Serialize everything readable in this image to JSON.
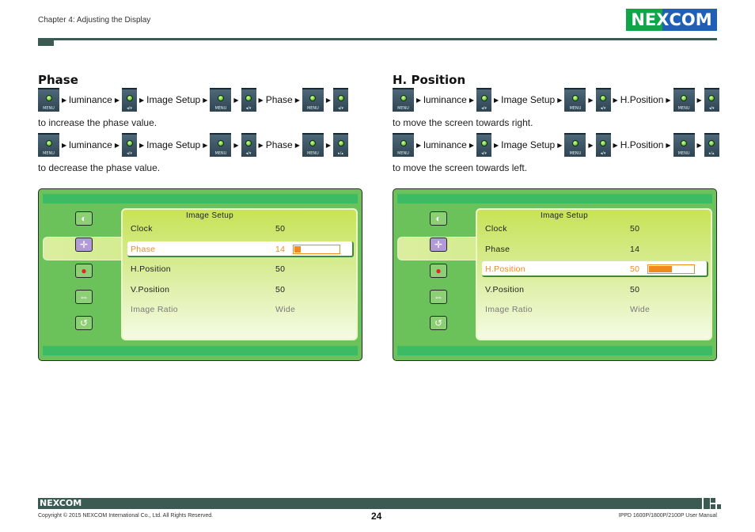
{
  "header": {
    "chapter": "Chapter 4: Adjusting the Display",
    "logo": {
      "ne": "NE",
      "x": "X",
      "com": "COM"
    },
    "colors": {
      "rule": "#3b5a52",
      "logo_green": "#0fa64a",
      "logo_blue": "#1f5fb5"
    }
  },
  "sections": [
    {
      "title": "Phase",
      "procedures": [
        {
          "steps": [
            {
              "type": "button",
              "button": "MENU"
            },
            {
              "type": "label",
              "text": "luminance"
            },
            {
              "type": "button",
              "button": "◂/▾"
            },
            {
              "type": "label",
              "text": "Image Setup"
            },
            {
              "type": "button",
              "button": "MENU"
            },
            {
              "type": "button",
              "button": "◂/▾"
            },
            {
              "type": "label",
              "text": "Phase"
            },
            {
              "type": "button",
              "button": "MENU"
            },
            {
              "type": "button",
              "button": "◂/▾"
            }
          ],
          "note": "to increase the phase value."
        },
        {
          "steps": [
            {
              "type": "button",
              "button": "MENU"
            },
            {
              "type": "label",
              "text": "luminance"
            },
            {
              "type": "button",
              "button": "◂/▾"
            },
            {
              "type": "label",
              "text": "Image Setup"
            },
            {
              "type": "button",
              "button": "MENU"
            },
            {
              "type": "button",
              "button": "◂/▾"
            },
            {
              "type": "label",
              "text": "Phase"
            },
            {
              "type": "button",
              "button": "MENU"
            },
            {
              "type": "button",
              "button": "▸/▴"
            }
          ],
          "note": "to decrease the phase value."
        }
      ],
      "osd": {
        "panel_title": "Image Setup",
        "rows": [
          {
            "label": "Clock",
            "value": "50",
            "state": "normal"
          },
          {
            "label": "Phase",
            "value": "14",
            "state": "selected",
            "meter_percent": 14
          },
          {
            "label": "H.Position",
            "value": "50",
            "state": "normal"
          },
          {
            "label": "V.Position",
            "value": "50",
            "state": "normal"
          },
          {
            "label": "Image Ratio",
            "value": "Wide",
            "state": "disabled"
          }
        ],
        "sidebar_icons": [
          "luminance-icon",
          "image-setup-icon",
          "color-temp-icon",
          "osd-setup-icon",
          "reset-icon"
        ],
        "active_icon": 1
      }
    },
    {
      "title": "H. Position",
      "procedures": [
        {
          "steps": [
            {
              "type": "button",
              "button": "MENU"
            },
            {
              "type": "label",
              "text": "luminance"
            },
            {
              "type": "button",
              "button": "◂/▾"
            },
            {
              "type": "label",
              "text": "Image Setup"
            },
            {
              "type": "button",
              "button": "MENU"
            },
            {
              "type": "button",
              "button": "◂/▾"
            },
            {
              "type": "label",
              "text": "H.Position"
            },
            {
              "type": "button",
              "button": "MENU"
            },
            {
              "type": "button",
              "button": "◂/▾"
            }
          ],
          "note": "to move the screen towards right."
        },
        {
          "steps": [
            {
              "type": "button",
              "button": "MENU"
            },
            {
              "type": "label",
              "text": "luminance"
            },
            {
              "type": "button",
              "button": "◂/▾"
            },
            {
              "type": "label",
              "text": "Image Setup"
            },
            {
              "type": "button",
              "button": "MENU"
            },
            {
              "type": "button",
              "button": "◂/▾"
            },
            {
              "type": "label",
              "text": "H.Position"
            },
            {
              "type": "button",
              "button": "MENU"
            },
            {
              "type": "button",
              "button": "▸/▴"
            }
          ],
          "note": "to move the screen towards left."
        }
      ],
      "osd": {
        "panel_title": "Image Setup",
        "rows": [
          {
            "label": "Clock",
            "value": "50",
            "state": "normal"
          },
          {
            "label": "Phase",
            "value": "14",
            "state": "normal"
          },
          {
            "label": "H.Position",
            "value": "50",
            "state": "selected",
            "meter_percent": 50
          },
          {
            "label": "V.Position",
            "value": "50",
            "state": "normal"
          },
          {
            "label": "Image Ratio",
            "value": "Wide",
            "state": "disabled"
          }
        ],
        "sidebar_icons": [
          "luminance-icon",
          "image-setup-icon",
          "color-temp-icon",
          "osd-setup-icon",
          "reset-icon"
        ],
        "active_icon": 1
      }
    }
  ],
  "osd_colors": {
    "frame": "#6cc25a",
    "bars": "#3dbb64",
    "highlight": "#f08a1d"
  },
  "footer": {
    "logo": "NEXCOM",
    "copyright": "Copyright © 2015 NEXCOM International Co., Ltd. All Rights Reserved.",
    "page_number": "24",
    "manual_title": "IPPD 1600P/1800P/2100P User Manual"
  }
}
